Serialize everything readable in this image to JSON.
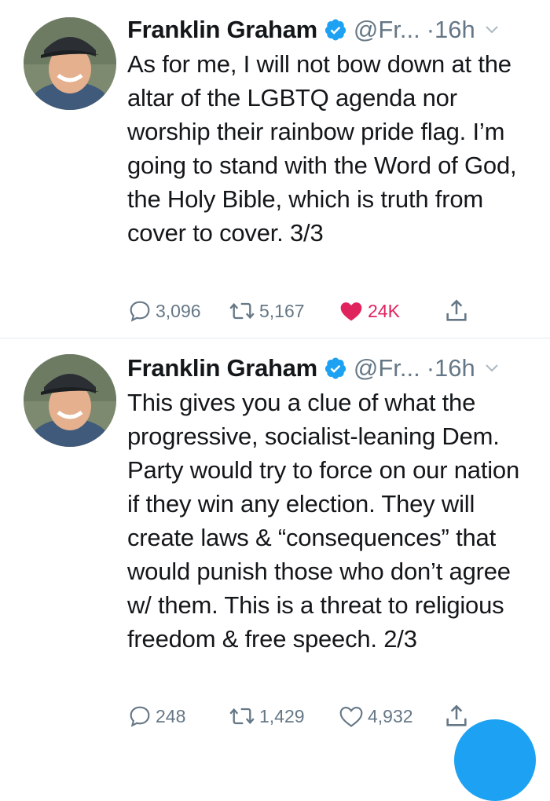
{
  "tweets": [
    {
      "name": "Franklin Graham",
      "handle": "@Fr...",
      "time": "·16h",
      "text": "As for me, I will not bow down at the altar of the LGBTQ agenda nor worship their rainbow pride flag. I’m going to stand with the Word of God, the Holy Bible, which is truth from cover to cover. 3/3",
      "replies": "3,096",
      "retweets": "5,167",
      "likes": "24K",
      "liked": true
    },
    {
      "name": "Franklin Graham",
      "handle": "@Fr...",
      "time": "·16h",
      "text": "This gives you a clue of what the progressive, socialist-leaning Dem. Party would try to force on our nation if they win any election. They will create laws & “consequences” that would punish those who don’t agree w/ them. This is a threat to religious freedom & free speech. 2/3",
      "replies": "248",
      "retweets": "1,429",
      "likes": "4,932",
      "liked": false
    }
  ],
  "colors": {
    "verified": "#1da1f2",
    "liked": "#e0245e",
    "muted": "#657786",
    "fab": "#1da1f2"
  },
  "icons": [
    "verified-badge-icon",
    "chevron-down-icon",
    "reply-icon",
    "retweet-icon",
    "like-icon",
    "share-icon"
  ]
}
